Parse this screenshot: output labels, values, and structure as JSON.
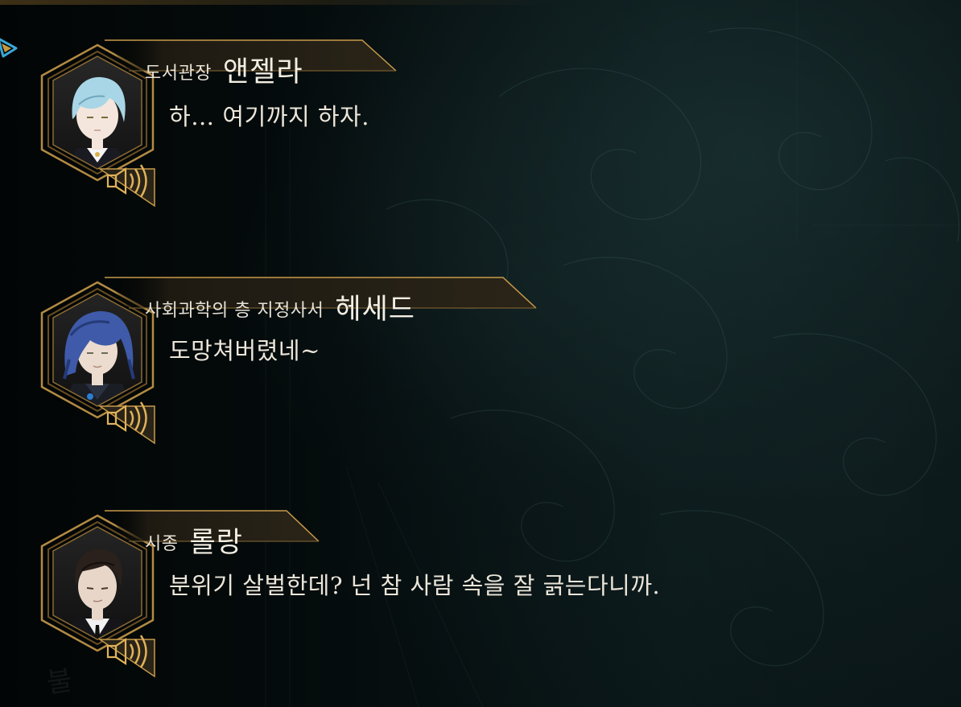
{
  "dialogue_log": [
    {
      "title": "도서관장",
      "name": "앤젤라",
      "line": "하… 여기까지 하자.",
      "portrait": {
        "hair_color": "#a9d6e6",
        "hair_shadow": "#6fa7bd",
        "skin_color": "#f4e6dc",
        "outfit_color": "#1a1a22",
        "collar_color": "#f5f5f5"
      }
    },
    {
      "title": "사회과학의 층 지정사서",
      "name": "헤세드",
      "line": "도망쳐버렸네~",
      "portrait": {
        "hair_color": "#3e5aa8",
        "hair_shadow": "#253a78",
        "skin_color": "#ecdccf",
        "outfit_color": "#1b1d24",
        "collar_color": "#2a3140"
      }
    },
    {
      "title": "시종",
      "name": "롤랑",
      "line": "분위기 살벌한데? 넌 참 사람 속을 잘 긁는다니까.",
      "portrait": {
        "hair_color": "#2a201c",
        "hair_shadow": "#140f0c",
        "skin_color": "#e8d6c8",
        "outfit_color": "#15151a",
        "collar_color": "#f2f2f2"
      }
    }
  ],
  "icons": {
    "voice": "speaker-sound-icon",
    "back": "back-arrow-icon"
  },
  "colors": {
    "frame_gold": "#c79a4a",
    "frame_gold_dark": "#6b4e22",
    "text_main": "#ece6da",
    "plate_fill": "#2a2418",
    "back_accent": "#3aa8d8"
  },
  "watermark": "불"
}
